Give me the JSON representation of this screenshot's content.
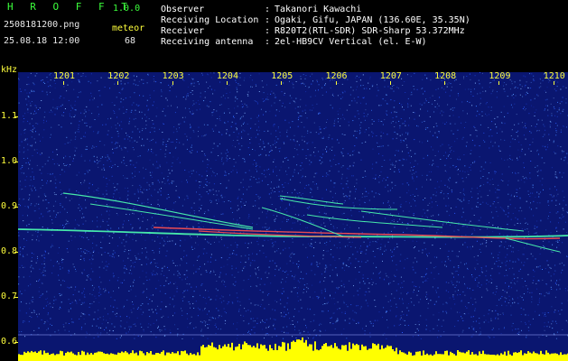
{
  "header": {
    "app_title": "H R O F F T",
    "version": "1.0.0",
    "filename": "2508181200.png",
    "datetime": "25.08.18 12:00",
    "meteor_label": "meteor",
    "meteor_count": "68"
  },
  "station": {
    "observer_label": "Observer",
    "observer_value": "Takanori Kawachi",
    "location_label": "Receiving Location",
    "location_value": "Ogaki, Gifu, JAPAN (136.60E, 35.35N)",
    "receiver_label": "Receiver",
    "receiver_value": "R820T2(RTL-SDR) SDR-Sharp 53.372MHz",
    "antenna_label": "Receiving antenna",
    "antenna_value": "2el-HB9CV Vertical (el. E-W)",
    "colon": ":"
  },
  "axes": {
    "y_unit": "kHz",
    "y_ticks": [
      "1.1",
      "1.0",
      "0.9",
      "0.8",
      "0.7",
      "0.6"
    ],
    "x_ticks": [
      "1201",
      "1202",
      "1203",
      "1204",
      "1205",
      "1206",
      "1207",
      "1208",
      "1209",
      "1210"
    ]
  },
  "colors": {
    "background": "#0a1670",
    "noise": "#3a7cff",
    "trail_strong": "#ff5050",
    "trail_mid": "#4cffb0",
    "power_bar": "#ffff00",
    "text_accent": "#ffff3c",
    "text_green": "#3cff3c"
  }
}
